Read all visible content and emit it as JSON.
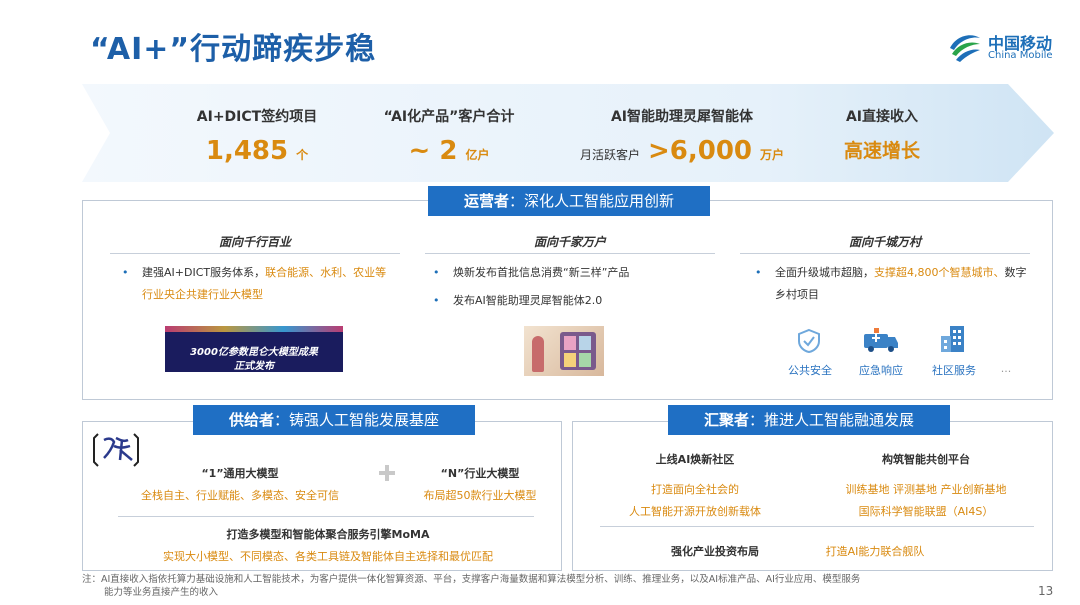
{
  "title": "“AI+”行动蹄疾步稳",
  "logo": {
    "cn": "中国移动",
    "en": "China Mobile"
  },
  "kpis": [
    {
      "label": "AI+DICT签约项目",
      "value": "1,485",
      "unit": "个"
    },
    {
      "label": "“AI化产品”客户合计",
      "value": "~ 2",
      "unit": "亿户"
    },
    {
      "label": "AI智能助理灵犀智能体",
      "prefix": "月活跃客户",
      "value": ">6,000",
      "unit": "万户"
    },
    {
      "label": "AI直接收入",
      "value": "高速增长"
    }
  ],
  "operator": {
    "tag_bold": "运营者",
    "tag_rest": "：深化人工智能应用创新",
    "columns": [
      {
        "title": "面向千行百业",
        "bullets": [
          {
            "plain": "建强AI+DICT服务体系，",
            "highlight": "联合能源、水利、农业等行业央企共建行业大模型"
          }
        ],
        "image_text": [
          "3000亿参数昆仑大模型成果",
          "正式发布"
        ]
      },
      {
        "title": "面向千家万户",
        "bullets": [
          {
            "plain": "焕新发布首批信息消费“新三样”产品",
            "highlight": ""
          },
          {
            "plain": "发布AI智能助理灵犀智能体2.0",
            "highlight": ""
          }
        ]
      },
      {
        "title": "面向千城万村",
        "bullets": [
          {
            "plain": "全面升级城市超脑，",
            "highlight": "支撑超4,800个智慧城市、",
            "plain2": "数字乡村项目"
          }
        ],
        "icons": [
          {
            "name": "shield-icon",
            "label": "公共安全"
          },
          {
            "name": "ambulance-icon",
            "label": "应急响应"
          },
          {
            "name": "building-icon",
            "label": "社区服务"
          },
          {
            "name": "more-icon",
            "label": "..."
          }
        ]
      }
    ]
  },
  "supplier": {
    "tag_bold": "供给者",
    "tag_rest": "：铸强人工智能发展基座",
    "model1_title": "“1”通用大模型",
    "model1_desc": "全栈自主、行业赋能、多模态、安全可信",
    "plus": "+",
    "modelN_title": "“N”行业大模型",
    "modelN_desc": "布局超50款行业大模型",
    "moma_title": "打造多模型和智能体聚合服务引擎MoMA",
    "moma_desc": "实现大小模型、不同模态、各类工具链及智能体自主选择和最优匹配"
  },
  "aggregator": {
    "tag_bold": "汇聚者",
    "tag_rest": "：推进人工智能融通发展",
    "left_title": "上线AI焕新社区",
    "left_desc": [
      "打造面向全社会的",
      "人工智能开源开放创新载体"
    ],
    "right_title": "构筑智能共创平台",
    "right_desc": [
      "训练基地  评测基地  产业创新基地",
      "国际科学智能联盟（AI4S）"
    ],
    "bottom_left": "强化产业投资布局",
    "bottom_right": "打造AI能力联合舰队"
  },
  "note": {
    "line1": "注：AI直接收入指依托算力基础设施和人工智能技术，为客户提供一体化智算资源、平台，支撑客户海量数据和算法模型分析、训练、推理业务，以及AI标准产品、AI行业应用、模型服务",
    "line2": "能力等业务直接产生的收入"
  },
  "page_number": "13",
  "colors": {
    "brand_blue": "#1d5fa8",
    "tag_blue": "#1f6fc4",
    "accent_orange": "#d98a10",
    "banner_light": "#eaf4fb"
  }
}
